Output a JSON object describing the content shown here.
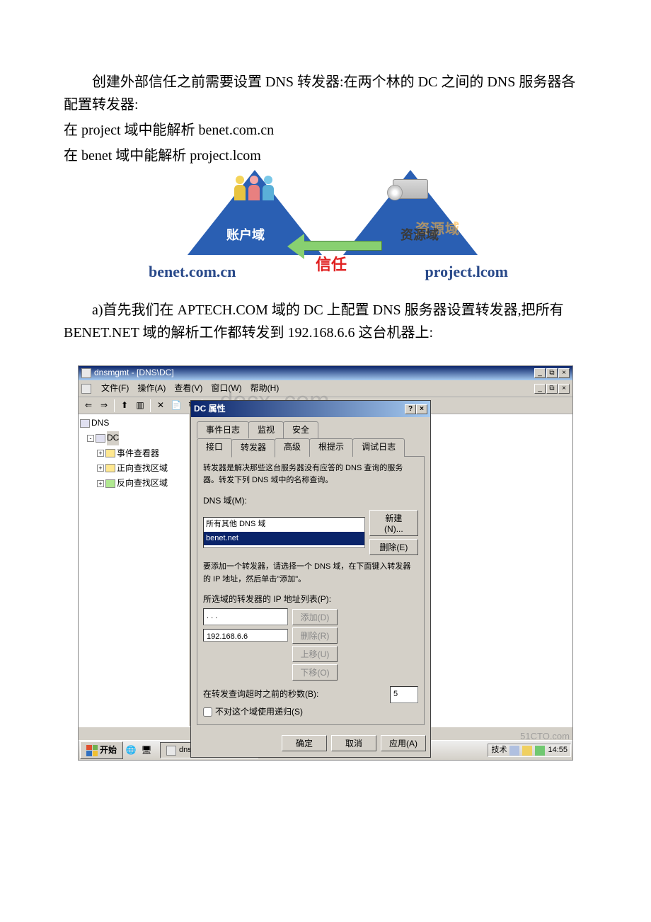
{
  "text": {
    "p1": "创建外部信任之前需要设置 DNS 转发器:在两个林的 DC 之间的 DNS 服务器各配置转发器:",
    "p2": "在 project 域中能解析 benet.com.cn",
    "p3": "在 benet 域中能解析 project.lcom",
    "p4": "a)首先我们在 APTECH.COM 域的 DC 上配置 DNS 服务器设置转发器,把所有 BENET.NET 域的解析工作都转发到 192.168.6.6 这台机器上:"
  },
  "diagram": {
    "account_label": "账户域",
    "resource_label": "资源域",
    "resource_label_shadow": "资源域",
    "trust_label": "信任",
    "domain_left": "benet.com.cn",
    "domain_right": "project.lcom"
  },
  "screenshot": {
    "window_title": "dnsmgmt - [DNS\\DC]",
    "menu": {
      "file": "文件(F)",
      "action": "操作(A)",
      "view": "查看(V)",
      "window": "窗口(W)",
      "help": "帮助(H)"
    },
    "tree": {
      "root": "DNS",
      "dc": "DC",
      "viewer": "事件查看器",
      "fwd": "正向查找区域",
      "rev": "反向查找区域"
    },
    "dialog": {
      "title": "DC 属性",
      "tabs_row1": {
        "eventlog": "事件日志",
        "monitor": "监视",
        "security": "安全"
      },
      "tabs_row2": {
        "interface": "接口",
        "forwarder": "转发器",
        "advanced": "高级",
        "roothint": "根提示",
        "debuglog": "调试日志"
      },
      "desc": "转发器是解决那些这台服务器没有应答的 DNS 查询的服务器。转发下列 DNS 域中的名称查询。",
      "dns_domain_label": "DNS 域(M):",
      "list_item1": "所有其他 DNS 域",
      "list_item2": "benet.net",
      "btn_new": "新建(N)...",
      "btn_delete": "删除(E)",
      "desc2": "要添加一个转发器，请选择一个 DNS 域，在下面键入转发器的 IP 地址，然后单击\"添加\"。",
      "ip_list_label": "所选域的转发器的 IP 地址列表(P):",
      "ip_input": " .   .   .  ",
      "ip_value": "192.168.6.6",
      "btn_add": "添加(D)",
      "btn_remove": "删除(R)",
      "btn_up": "上移(U)",
      "btn_down": "下移(O)",
      "timeout_label": "在转发查询超时之前的秒数(B):",
      "timeout_value": "5",
      "no_recursion": "不对这个域使用递归(S)",
      "btn_ok": "确定",
      "btn_cancel": "取消",
      "btn_apply": "应用(A)"
    },
    "taskbar": {
      "start": "开始",
      "task": "dnsmgmt - [DNS\\DC]",
      "clock": "14:55"
    },
    "watermark_docx": ".docx .com",
    "watermark_51cto_1": "51CTO.com",
    "watermark_51cto_2": "技术"
  }
}
